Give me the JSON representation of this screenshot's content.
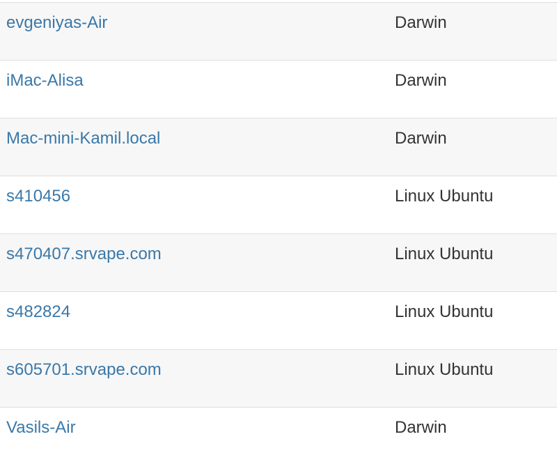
{
  "hosts": [
    {
      "name": "evgeniyas-Air",
      "os": "Darwin"
    },
    {
      "name": "iMac-Alisa",
      "os": "Darwin"
    },
    {
      "name": "Mac-mini-Kamil.local",
      "os": "Darwin"
    },
    {
      "name": "s410456",
      "os": "Linux Ubuntu"
    },
    {
      "name": "s470407.srvape.com",
      "os": "Linux Ubuntu"
    },
    {
      "name": "s482824",
      "os": "Linux Ubuntu"
    },
    {
      "name": "s605701.srvape.com",
      "os": "Linux Ubuntu"
    },
    {
      "name": "Vasils-Air",
      "os": "Darwin"
    }
  ],
  "colors": {
    "link": "#3a78a8",
    "text": "#333333",
    "row_striped": "#f7f7f7",
    "row_plain": "#ffffff",
    "border": "#dedede"
  }
}
